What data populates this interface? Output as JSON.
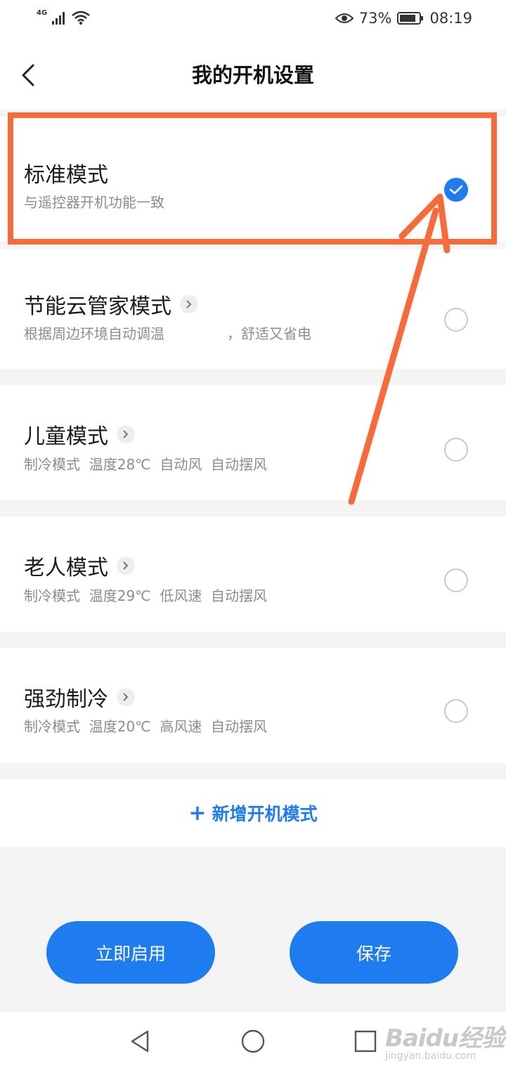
{
  "status_bar": {
    "network": "4G",
    "battery": "73%",
    "time": "08:19"
  },
  "header": {
    "title": "我的开机设置"
  },
  "modes": [
    {
      "title": "标准模式",
      "description": "与遥控器开机功能一致",
      "selected": true,
      "has_detail": false
    },
    {
      "title": "节能云管家模式",
      "description": "根据周边环境自动调温              ，舒适又省电",
      "selected": false,
      "has_detail": true
    },
    {
      "title": "儿童模式",
      "description": "制冷模式  温度28℃  自动风  自动摆风",
      "selected": false,
      "has_detail": true
    },
    {
      "title": "老人模式",
      "description": "制冷模式  温度29℃  低风速  自动摆风",
      "selected": false,
      "has_detail": true
    },
    {
      "title": "强劲制冷",
      "description": "制冷模式  温度20℃  高风速  自动摆风",
      "selected": false,
      "has_detail": true
    }
  ],
  "add_mode": {
    "label": "新增开机模式"
  },
  "actions": {
    "enable_now": "立即启用",
    "save": "保存"
  },
  "watermark": {
    "logo": "Baidu经验",
    "site": "jingyan.baidu.com"
  },
  "colors": {
    "accent": "#1f7cf0",
    "annotation": "#f76b3a"
  }
}
